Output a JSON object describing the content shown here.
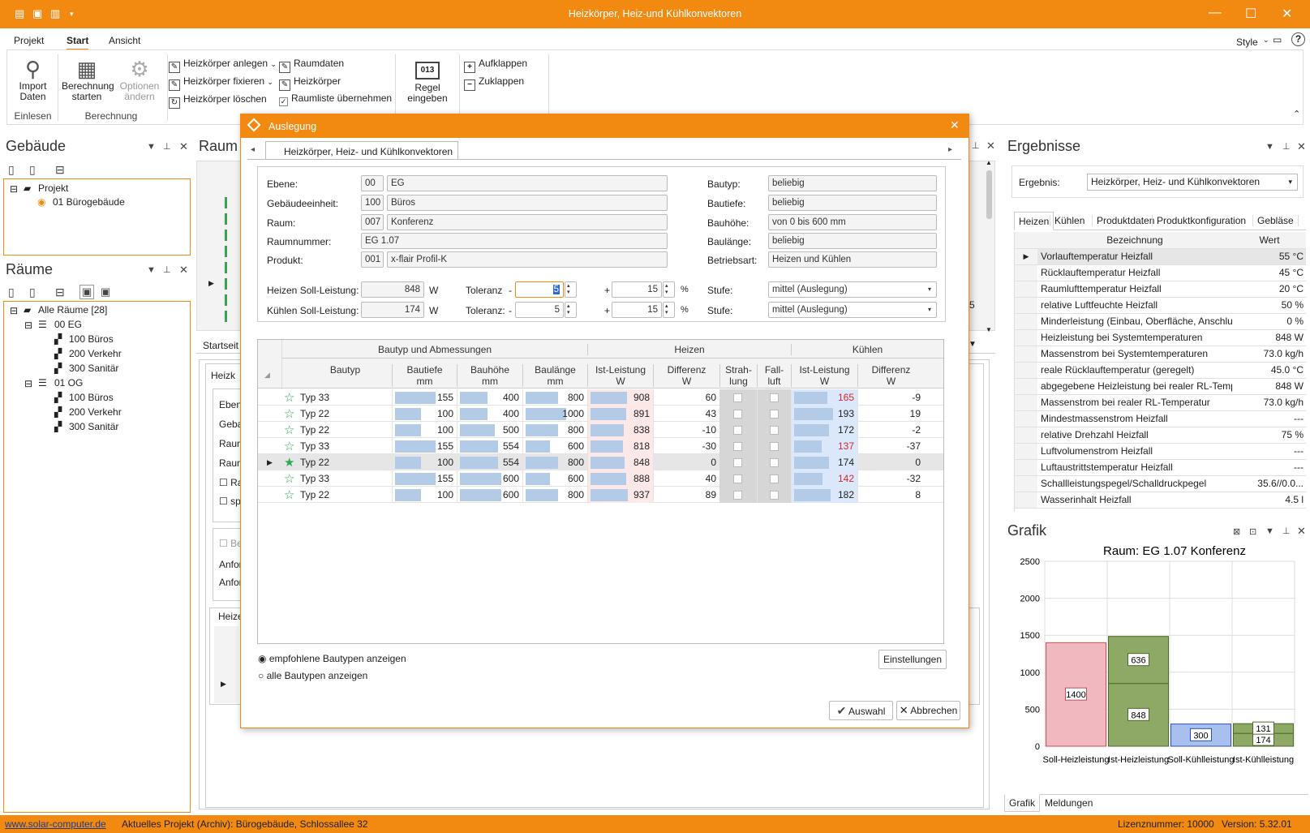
{
  "window": {
    "title": "Heizkörper, Heiz-und Kühlkonvektoren",
    "min": "—",
    "max": "☐",
    "close": "✕"
  },
  "menu": {
    "items": [
      "Projekt",
      "Start",
      "Ansicht"
    ],
    "style": "Style",
    "help": "?"
  },
  "ribbon": {
    "import": "Import Daten",
    "calc": "Berechnung starten",
    "options": "Optionen ändern",
    "grp_einlesen": "Einlesen",
    "grp_berechnung": "Berechnung",
    "anlegen": "Heizkörper anlegen",
    "fixieren": "Heizkörper fixieren",
    "loeschen": "Heizkörper löschen",
    "raumdaten": "Raumdaten",
    "heizkoerper": "Heizkörper",
    "raumliste": "Raumliste übernehmen",
    "regel_num": "013",
    "regel": "Regel eingeben",
    "aufklappen": "Aufklappen",
    "zuklappen": "Zuklappen"
  },
  "gebaeude": {
    "title": "Gebäude",
    "root": "Projekt",
    "child": "01 Bürogebäude"
  },
  "raeume": {
    "title": "Räume",
    "root": "Alle Räume [28]",
    "eg": "00 EG",
    "eg1": "100 Büros",
    "eg2": "200 Verkehr",
    "eg3": "300 Sanitär",
    "og": "01 OG",
    "og1": "100 Büros",
    "og2": "200 Verkehr",
    "og3": "300 Sanitär"
  },
  "raum_panel": {
    "title": "Raum",
    "startseite": "Startseit",
    "heizk": "Heizk",
    "ebene": "Ebene",
    "geba": "Geba",
    "raum1": "Raum",
    "raum2": "Raum",
    "ra": "Ra",
    "sp": "sp",
    "be": "Be",
    "anfor1": "Anfor",
    "anfor2": "Anfor",
    "heize": "Heize",
    "val5": "5"
  },
  "dialog": {
    "title": "Auslegung",
    "tab": "Heizkörper, Heiz- und Kühlkonvektoren",
    "ebene_l": "Ebene:",
    "ebene_c": "00",
    "ebene_v": "EG",
    "geb_l": "Gebäudeeinheit:",
    "geb_c": "100",
    "geb_v": "Büros",
    "raum_l": "Raum:",
    "raum_c": "007",
    "raum_v": "Konferenz",
    "rn_l": "Raumnummer:",
    "rn_v": "EG 1.07",
    "prod_l": "Produkt:",
    "prod_c": "001",
    "prod_v": "x-flair Profil-K",
    "bautyp_l": "Bautyp:",
    "bautyp_v": "beliebig",
    "bautiefe_l": "Bautiefe:",
    "bautiefe_v": "beliebig",
    "bauhoehe_l": "Bauhöhe:",
    "bauhoehe_v": "von 0 bis 600 mm",
    "baulaenge_l": "Baulänge:",
    "baulaenge_v": "beliebig",
    "betrieb_l": "Betriebsart:",
    "betrieb_v": "Heizen und Kühlen",
    "heizen_l": "Heizen Soll-Leistung:",
    "heizen_v": "848",
    "unit_w": "W",
    "kuehlen_l": "Kühlen Soll-Leistung:",
    "kuehlen_v": "174",
    "tol1_l": "Toleranz",
    "tol2_l": "Toleranz:",
    "minus": "-",
    "plus": "+",
    "tol1_minus": "5",
    "tol1_plus": "15",
    "tol2_minus": "5",
    "tol2_plus": "15",
    "pct": "%",
    "stufe_l": "Stufe:",
    "stufe1": "mittel (Auslegung)",
    "stufe2": "mittel (Auslegung)",
    "grp_bautyp": "Bautyp und Abmessungen",
    "grp_heizen": "Heizen",
    "grp_kuehlen": "Kühlen",
    "cols": {
      "bautyp": "Bautyp",
      "bautiefe": "Bautiefe",
      "bauhoehe": "Bauhöhe",
      "baulaenge": "Baulänge",
      "ist": "Ist-Leistung",
      "diff": "Differenz",
      "strah": "Strah-",
      "lung": "lung",
      "fall": "Fall-",
      "luft": "luft",
      "mm": "mm",
      "w": "W"
    },
    "rows": [
      {
        "typ": "Typ 33",
        "tiefe": "155",
        "hoehe": "400",
        "laenge": "800",
        "h_ist": "908",
        "h_diff": "60",
        "k_ist": "165",
        "k_diff": "-9",
        "kred": true,
        "sel": false
      },
      {
        "typ": "Typ 22",
        "tiefe": "100",
        "hoehe": "400",
        "laenge": "1000",
        "h_ist": "891",
        "h_diff": "43",
        "k_ist": "193",
        "k_diff": "19",
        "kred": false,
        "sel": false
      },
      {
        "typ": "Typ 22",
        "tiefe": "100",
        "hoehe": "500",
        "laenge": "800",
        "h_ist": "838",
        "h_diff": "-10",
        "k_ist": "172",
        "k_diff": "-2",
        "kred": false,
        "sel": false
      },
      {
        "typ": "Typ 33",
        "tiefe": "155",
        "hoehe": "554",
        "laenge": "600",
        "h_ist": "818",
        "h_diff": "-30",
        "k_ist": "137",
        "k_diff": "-37",
        "kred": true,
        "sel": false
      },
      {
        "typ": "Typ 22",
        "tiefe": "100",
        "hoehe": "554",
        "laenge": "800",
        "h_ist": "848",
        "h_diff": "0",
        "k_ist": "174",
        "k_diff": "0",
        "kred": false,
        "sel": true
      },
      {
        "typ": "Typ 33",
        "tiefe": "155",
        "hoehe": "600",
        "laenge": "600",
        "h_ist": "888",
        "h_diff": "40",
        "k_ist": "142",
        "k_diff": "-32",
        "kred": true,
        "sel": false
      },
      {
        "typ": "Typ 22",
        "tiefe": "100",
        "hoehe": "600",
        "laenge": "800",
        "h_ist": "937",
        "h_diff": "89",
        "k_ist": "182",
        "k_diff": "8",
        "kred": false,
        "sel": false
      }
    ],
    "radio1": "empfohlene Bautypen anzeigen",
    "radio2": "alle Bautypen anzeigen",
    "einstellungen": "Einstellungen",
    "auswahl": "Auswahl",
    "abbrechen": "Abbrechen"
  },
  "ergebnisse": {
    "title": "Ergebnisse",
    "ergebnis_l": "Ergebnis:",
    "ergebnis_v": "Heizkörper, Heiz- und Kühlkonvektoren",
    "tabs": [
      "Heizen",
      "Kühlen",
      "Produktdaten",
      "Produktkonfiguration",
      "Gebläse"
    ],
    "col_bez": "Bezeichnung",
    "col_wert": "Wert",
    "rows": [
      [
        "Vorlauftemperatur Heizfall",
        "55 °C"
      ],
      [
        "Rücklauftemperatur Heizfall",
        "45 °C"
      ],
      [
        "Raumlufttemperatur Heizfall",
        "20 °C"
      ],
      [
        "relative Luftfeuchte Heizfall",
        "50 %"
      ],
      [
        "Minderleistung (Einbau, Oberfläche, Anschluss)",
        "0 %"
      ],
      [
        "Heizleistung bei Systemtemperaturen",
        "848 W"
      ],
      [
        "Massenstrom bei Systemtemperaturen",
        "73.0 kg/h"
      ],
      [
        "reale Rücklauftemperatur (geregelt)",
        "45.0 °C"
      ],
      [
        "abgegebene Heizleistung bei realer RL-Temper...",
        "848 W"
      ],
      [
        "Massenstrom bei realer RL-Temperatur",
        "73.0 kg/h"
      ],
      [
        "Mindestmassenstrom Heizfall",
        "---"
      ],
      [
        "relative Drehzahl Heizfall",
        "75 %"
      ],
      [
        "Luftvolumenstrom Heizfall",
        "---"
      ],
      [
        "Luftaustrittstemperatur Heizfall",
        "---"
      ],
      [
        "Schallleistungspegel/Schalldruckpegel",
        "35.6//0.0..."
      ],
      [
        "Wasserinhalt Heizfall",
        "4.5 l"
      ]
    ]
  },
  "grafik": {
    "title": "Grafik",
    "tabs": [
      "Grafik",
      "Meldungen"
    ]
  },
  "chart_data": {
    "type": "bar",
    "title": "Raum: EG 1.07 Konferenz",
    "categories": [
      "Soll-Heizleistung",
      "Ist-Heizleistung",
      "Soll-Kühlleistung",
      "Ist-Kühlleistung"
    ],
    "yticks": [
      "2500",
      "2000",
      "1500",
      "1000",
      "500",
      "0"
    ],
    "ylim": [
      0,
      2500
    ],
    "bars": [
      {
        "segments": [
          {
            "value": 1400,
            "label": "1400",
            "color": "#f1b9bf",
            "stroke": "#c0505a"
          }
        ]
      },
      {
        "segments": [
          {
            "value": 848,
            "label": "848",
            "color": "#8ea866",
            "stroke": "#4f6a2a"
          },
          {
            "value": 636,
            "label": "636",
            "color": "#8ea866",
            "stroke": "#4f6a2a"
          }
        ]
      },
      {
        "segments": [
          {
            "value": 300,
            "label": "300",
            "color": "#a9c0ee",
            "stroke": "#2a4fb8"
          }
        ]
      },
      {
        "segments": [
          {
            "value": 174,
            "label": "174",
            "color": "#8ea866",
            "stroke": "#4f6a2a"
          },
          {
            "value": 131,
            "label": "131",
            "color": "#8ea866",
            "stroke": "#4f6a2a"
          }
        ]
      }
    ]
  },
  "status": {
    "url": "www.solar-computer.de",
    "project": "Aktuelles Projekt (Archiv): Bürogebäude, Schlossallee 32",
    "lizenz": "Lizenznummer: 10000",
    "version": "Version: 5.32.01"
  }
}
